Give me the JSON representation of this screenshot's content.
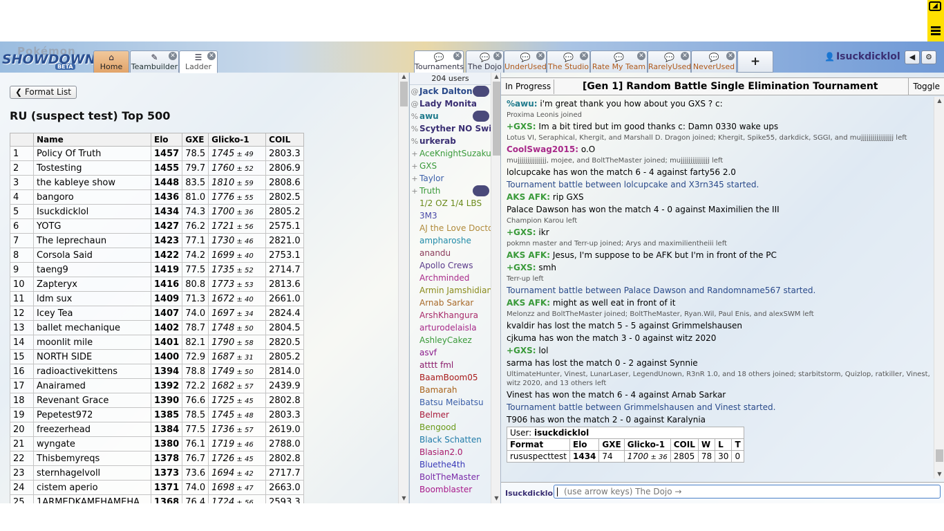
{
  "header": {
    "logo": {
      "line1": "Pokémon",
      "line2": "SHOWDOWN",
      "badge": "BETA"
    },
    "main_tabs": [
      {
        "label": "Home",
        "icon": "home-icon",
        "active": true
      },
      {
        "label": "Teambuilder",
        "icon": "edit-icon"
      },
      {
        "label": "Ladder",
        "icon": "list-icon",
        "selected": true
      }
    ],
    "room_tabs": [
      {
        "label": "Tournaments",
        "selected": true
      },
      {
        "label": "The Dojo"
      },
      {
        "label": "UnderUsed"
      },
      {
        "label": "The Studio"
      },
      {
        "label": "Rate My Team"
      },
      {
        "label": "RarelyUsed"
      },
      {
        "label": "NeverUsed"
      }
    ],
    "add_tab": "+",
    "username": "Isuckdicklol",
    "sound_icon": "◀",
    "settings_icon": "⚙"
  },
  "ladder": {
    "format_button": "Format List",
    "title": "RU (suspect test) Top 500",
    "columns": [
      "",
      "Name",
      "Elo",
      "GXE",
      "Glicko-1",
      "COIL"
    ],
    "rows": [
      [
        "1",
        "Policy Of Truth",
        "1457",
        "78.5",
        "1745",
        "49",
        "2803.3"
      ],
      [
        "2",
        "Tostesting",
        "1455",
        "79.7",
        "1760",
        "52",
        "2806.9"
      ],
      [
        "3",
        "the kableye show",
        "1448",
        "83.5",
        "1810",
        "59",
        "2808.6"
      ],
      [
        "4",
        "bangoro",
        "1436",
        "81.0",
        "1776",
        "55",
        "2802.5"
      ],
      [
        "5",
        "Isuckdicklol",
        "1434",
        "74.3",
        "1700",
        "36",
        "2805.2"
      ],
      [
        "6",
        "YOTG",
        "1427",
        "76.2",
        "1721",
        "56",
        "2575.1"
      ],
      [
        "7",
        "The leprechaun",
        "1423",
        "77.1",
        "1730",
        "46",
        "2821.0"
      ],
      [
        "8",
        "Corsola Said",
        "1422",
        "74.2",
        "1699",
        "40",
        "2753.1"
      ],
      [
        "9",
        "taeng9",
        "1419",
        "77.5",
        "1735",
        "52",
        "2714.7"
      ],
      [
        "10",
        "Zapteryx",
        "1416",
        "80.8",
        "1773",
        "53",
        "2813.6"
      ],
      [
        "11",
        "ldm sux",
        "1409",
        "71.3",
        "1672",
        "40",
        "2661.0"
      ],
      [
        "12",
        "Icey Tea",
        "1407",
        "74.0",
        "1697",
        "34",
        "2824.4"
      ],
      [
        "13",
        "ballet mechanique",
        "1402",
        "78.7",
        "1748",
        "50",
        "2804.5"
      ],
      [
        "14",
        "moonlit mile",
        "1401",
        "82.1",
        "1790",
        "58",
        "2820.5"
      ],
      [
        "15",
        "NORTH SIDE",
        "1400",
        "72.9",
        "1687",
        "31",
        "2805.2"
      ],
      [
        "16",
        "radioactivekittens",
        "1394",
        "78.8",
        "1749",
        "50",
        "2814.0"
      ],
      [
        "17",
        "Anairamed",
        "1392",
        "72.2",
        "1682",
        "57",
        "2439.9"
      ],
      [
        "18",
        "Revenant Grace",
        "1390",
        "76.6",
        "1725",
        "45",
        "2802.8"
      ],
      [
        "19",
        "Pepetest972",
        "1385",
        "78.5",
        "1745",
        "48",
        "2803.3"
      ],
      [
        "20",
        "freezerhead",
        "1384",
        "77.5",
        "1736",
        "57",
        "2619.0"
      ],
      [
        "21",
        "wyngate",
        "1380",
        "76.1",
        "1719",
        "46",
        "2788.0"
      ],
      [
        "22",
        "Thisbemyreqs",
        "1378",
        "76.7",
        "1726",
        "45",
        "2802.8"
      ],
      [
        "23",
        "sternhagelvoll",
        "1373",
        "73.6",
        "1694",
        "42",
        "2717.7"
      ],
      [
        "24",
        "cistem aperio",
        "1371",
        "74.0",
        "1698",
        "47",
        "2663.0"
      ],
      [
        "25",
        "1ARMEDKAMEHAMEHA",
        "1368",
        "76.4",
        "1724",
        "56",
        "2593.3"
      ]
    ]
  },
  "userlist": {
    "count": "204 users",
    "users": [
      {
        "group": "@",
        "name": "Jack Dalton",
        "color": "#2a4a8a",
        "bold": true,
        "avatar": true
      },
      {
        "group": "@",
        "name": "Lady Monita",
        "color": "#3a2f73",
        "bold": true
      },
      {
        "group": "%",
        "name": "awu",
        "color": "#1f7a8c",
        "bold": true,
        "avatar": true
      },
      {
        "group": "%",
        "name": "Scyther NO Swip",
        "color": "#3a2f73",
        "bold": true
      },
      {
        "group": "%",
        "name": "urkerab",
        "color": "#3a2f73",
        "bold": true
      },
      {
        "group": "+",
        "name": "AceKnightSuzaku",
        "color": "#3a9a3a"
      },
      {
        "group": "+",
        "name": "GXS",
        "color": "#3a9a3a"
      },
      {
        "group": "+",
        "name": "Taylor",
        "color": "#3a5ea8"
      },
      {
        "group": "+",
        "name": "Truth",
        "color": "#3a9a3a",
        "avatar": true
      },
      {
        "group": "",
        "name": "1/2 OZ 1/4 LBS",
        "color": "#6a8a1a"
      },
      {
        "group": "",
        "name": "3M3",
        "color": "#4a4aa8"
      },
      {
        "group": "",
        "name": "AJ the Love Doctor",
        "color": "#b08a3a"
      },
      {
        "group": "",
        "name": "ampharoshe",
        "color": "#1f8aa8"
      },
      {
        "group": "",
        "name": "anandu",
        "color": "#8a3a5a"
      },
      {
        "group": "",
        "name": "Apollo Crews",
        "color": "#5a3a8a"
      },
      {
        "group": "",
        "name": "Archminded",
        "color": "#a82a8a"
      },
      {
        "group": "",
        "name": "Armin Jamshidian",
        "color": "#8a8a1a"
      },
      {
        "group": "",
        "name": "Arnab Sarkar",
        "color": "#a86a2a"
      },
      {
        "group": "",
        "name": "ArshKhangura",
        "color": "#a82a6a"
      },
      {
        "group": "",
        "name": "arturodelaisla",
        "color": "#a82a8a"
      },
      {
        "group": "",
        "name": "AshleyCakez",
        "color": "#3a9a3a"
      },
      {
        "group": "",
        "name": "asvf",
        "color": "#8a1a8a"
      },
      {
        "group": "",
        "name": "atttt fml",
        "color": "#8a1a6a"
      },
      {
        "group": "",
        "name": "BaamBoom05",
        "color": "#a81a1a"
      },
      {
        "group": "",
        "name": "Bamarah",
        "color": "#a8621a"
      },
      {
        "group": "",
        "name": "Batsu Meibatsu",
        "color": "#3a5ea8"
      },
      {
        "group": "",
        "name": "Belmer",
        "color": "#a81a3a"
      },
      {
        "group": "",
        "name": "Bengood",
        "color": "#6a9a1a"
      },
      {
        "group": "",
        "name": "Black Schatten",
        "color": "#1f7aa8"
      },
      {
        "group": "",
        "name": "Blasian2.0",
        "color": "#a81a6a"
      },
      {
        "group": "",
        "name": "Bluethe4th",
        "color": "#3a3ab8"
      },
      {
        "group": "",
        "name": "BoltTheMaster",
        "color": "#7a2aa8"
      },
      {
        "group": "",
        "name": "Boomblaster",
        "color": "#a81a8a"
      }
    ]
  },
  "room": {
    "in_progress": "In Progress",
    "tour_title": "[Gen 1] Random Battle Single Elimination Tournament",
    "toggle": "Toggle",
    "log": [
      {
        "type": "chat",
        "user": "%awu:",
        "ucolor": "#1f7a8c",
        "text": " i'm great thank you how about you GXS ? c:"
      },
      {
        "type": "small",
        "text": "Proxima Leonis joined"
      },
      {
        "type": "chat",
        "user": "+GXS:",
        "ucolor": "#3a9a3a",
        "text": " Im a bit tired but im good thanks c: Damn 0330 wake ups"
      },
      {
        "type": "small",
        "text": "Lotus VI, Seraphical, Khergit, and Marshall D. Dragon joined; Khergit, Spike55, darkdick, SGGI, and mujjjjjjjjjjjjjjjjj left"
      },
      {
        "type": "chat",
        "user": "CoolSwag2015:",
        "ucolor": "#a82a8a",
        "text": " o.O"
      },
      {
        "type": "small",
        "text": "mujjjjjjjjjjjjjjj, mojee, and BoltTheMaster joined; mujjjjjjjjjjjjjjj left"
      },
      {
        "type": "plain",
        "text": "lolcupcake has won the match 6 - 4 against farty56 2.0"
      },
      {
        "type": "notice",
        "text": "Tournament battle between lolcupcake and X3rn345 started."
      },
      {
        "type": "chat",
        "user": "AKS AFK:",
        "ucolor": "#3a9a3a",
        "text": " rip GXS"
      },
      {
        "type": "plain",
        "text": "Palace Dawson has won the match 4 - 0 against Maximilien the III"
      },
      {
        "type": "small",
        "text": "Champion Karou left"
      },
      {
        "type": "chat",
        "user": "+GXS:",
        "ucolor": "#3a9a3a",
        "text": " ikr"
      },
      {
        "type": "small",
        "text": "pokmn master and Terr-up joined; Arys and maximilientheiii left"
      },
      {
        "type": "chat",
        "user": "AKS AFK:",
        "ucolor": "#3a9a3a",
        "text": " Jesus, I'm suppose to be AFK but I'm in front of the PC"
      },
      {
        "type": "chat",
        "user": "+GXS:",
        "ucolor": "#3a9a3a",
        "text": " smh"
      },
      {
        "type": "small",
        "text": "Terr-up left"
      },
      {
        "type": "notice",
        "text": "Tournament battle between Palace Dawson and Randomname567 started."
      },
      {
        "type": "chat",
        "user": "AKS AFK:",
        "ucolor": "#3a9a3a",
        "text": " might as well eat in front of it"
      },
      {
        "type": "small",
        "text": "Melonzz and BoltTheMaster joined; BoltTheMaster, Ryan.Wil, Paul Enis, and alexSWM left"
      },
      {
        "type": "plain",
        "text": "kvaldir has lost the match 5 - 5 against Grimmelshausen"
      },
      {
        "type": "plain",
        "text": "cjkuma has won the match 3 - 0 against witz 2020"
      },
      {
        "type": "chat",
        "user": "+GXS:",
        "ucolor": "#3a9a3a",
        "text": " lol"
      },
      {
        "type": "plain",
        "text": "sarma has lost the match 0 - 2 against Synnie"
      },
      {
        "type": "small",
        "text": "UltimateHunter, Vinest, LunarLaser, LegendUnown, R3nR 1.0, and 18 others joined; starbitstorm, Quizlop, ratkiller, Vinest, witz 2020, and 13 others left"
      },
      {
        "type": "plain",
        "text": "Vinest has won the match 6 - 4 against Arnab Sarkar"
      },
      {
        "type": "notice",
        "text": "Tournament battle between Grimmelshausen and Vinest started."
      },
      {
        "type": "plain",
        "text": "T906 has won the match 2 - 0 against Karalynia"
      }
    ],
    "rank_table": {
      "user_label": "User:",
      "user": "isuckdicklol",
      "headers": [
        "Format",
        "Elo",
        "GXE",
        "Glicko-1",
        "COIL",
        "W",
        "L",
        "T"
      ],
      "row": [
        "rususpecttest",
        "1434",
        "74",
        "1700",
        "36",
        "2805",
        "78",
        "30",
        "0"
      ]
    },
    "compose_user": "Isuckdicklol",
    "compose_placeholder": "(use arrow keys) The Dojo →"
  }
}
